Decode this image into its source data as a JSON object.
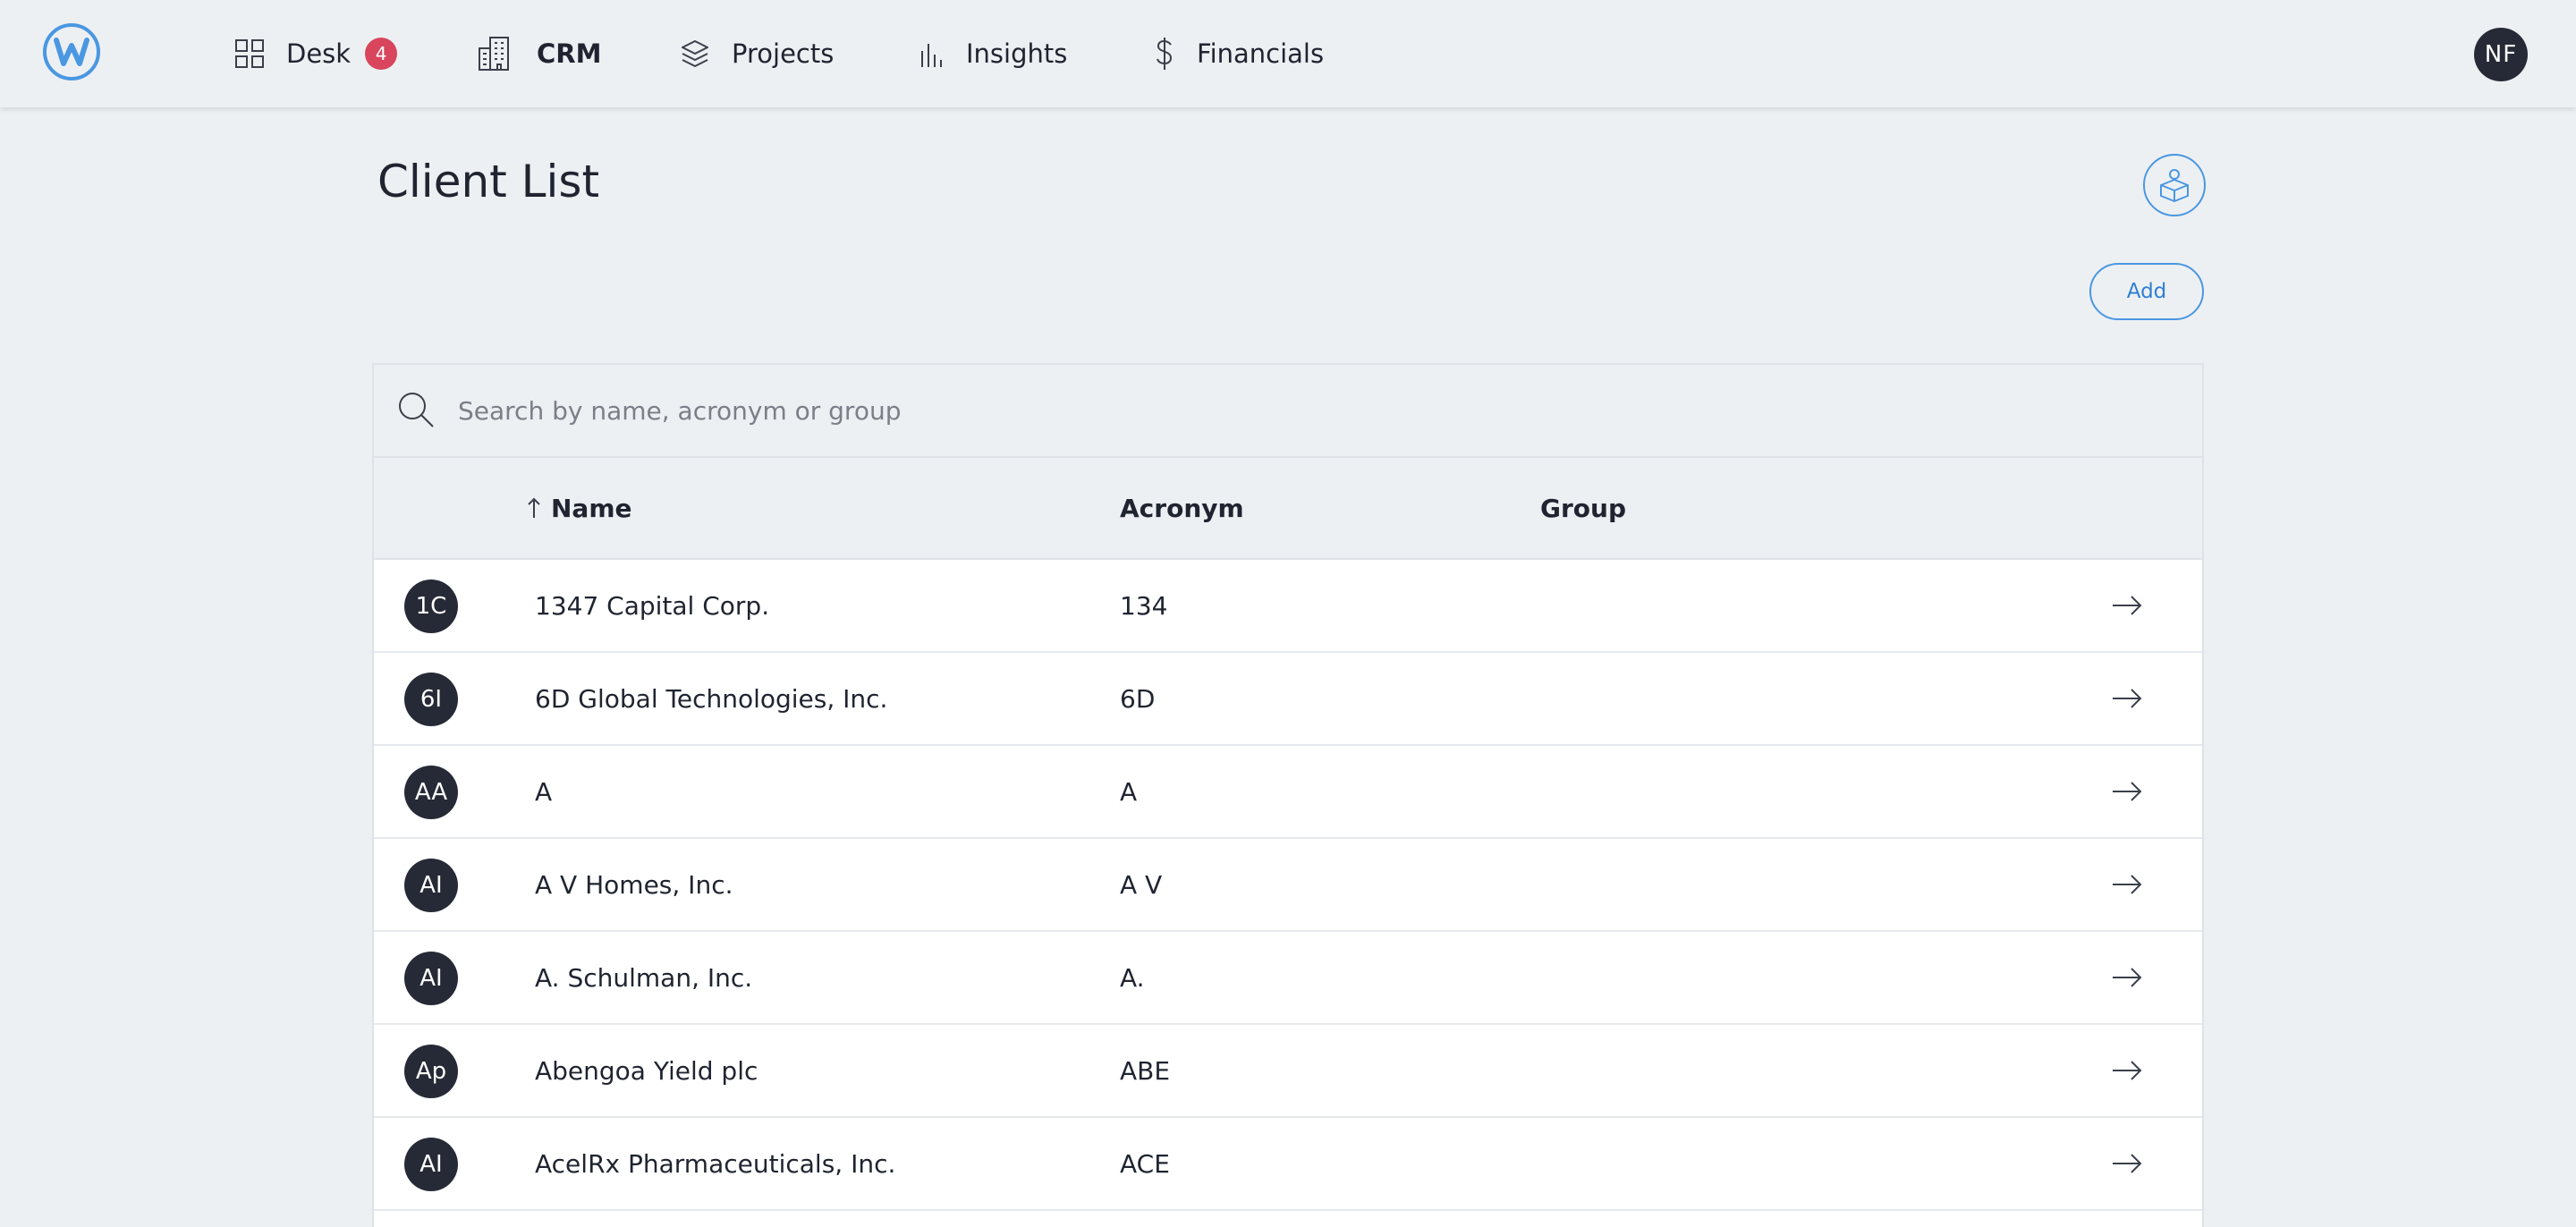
{
  "nav": {
    "items": [
      {
        "label": "Desk",
        "badge": "4",
        "icon": "grid-icon"
      },
      {
        "label": "CRM",
        "icon": "building-icon"
      },
      {
        "label": "Projects",
        "icon": "layers-icon"
      },
      {
        "label": "Insights",
        "icon": "bar-chart-icon"
      },
      {
        "label": "Financials",
        "icon": "dollar-icon"
      }
    ],
    "user_initials": "NF"
  },
  "page": {
    "title": "Client List",
    "add_label": "Add",
    "search_placeholder": "Search by name, acronym or group"
  },
  "table": {
    "columns": [
      "Name",
      "Acronym",
      "Group"
    ],
    "sort": {
      "column": "Name",
      "direction": "ascending"
    },
    "rows": [
      {
        "initials": "1C",
        "name": "1347 Capital Corp.",
        "acronym": "134",
        "group": ""
      },
      {
        "initials": "6I",
        "name": "6D Global Technologies, Inc.",
        "acronym": "6D",
        "group": ""
      },
      {
        "initials": "AA",
        "name": "A",
        "acronym": "A",
        "group": ""
      },
      {
        "initials": "AI",
        "name": "A V Homes, Inc.",
        "acronym": "A V",
        "group": ""
      },
      {
        "initials": "AI",
        "name": "A. Schulman, Inc.",
        "acronym": "A.",
        "group": ""
      },
      {
        "initials": "Ap",
        "name": "Abengoa Yield plc",
        "acronym": "ABE",
        "group": ""
      },
      {
        "initials": "AI",
        "name": "AcelRx Pharmaceuticals, Inc.",
        "acronym": "ACE",
        "group": ""
      }
    ]
  },
  "colors": {
    "accent": "#4a97e2",
    "badge": "#d8455c",
    "avatar": "#262a36",
    "background": "#edf0f3"
  }
}
